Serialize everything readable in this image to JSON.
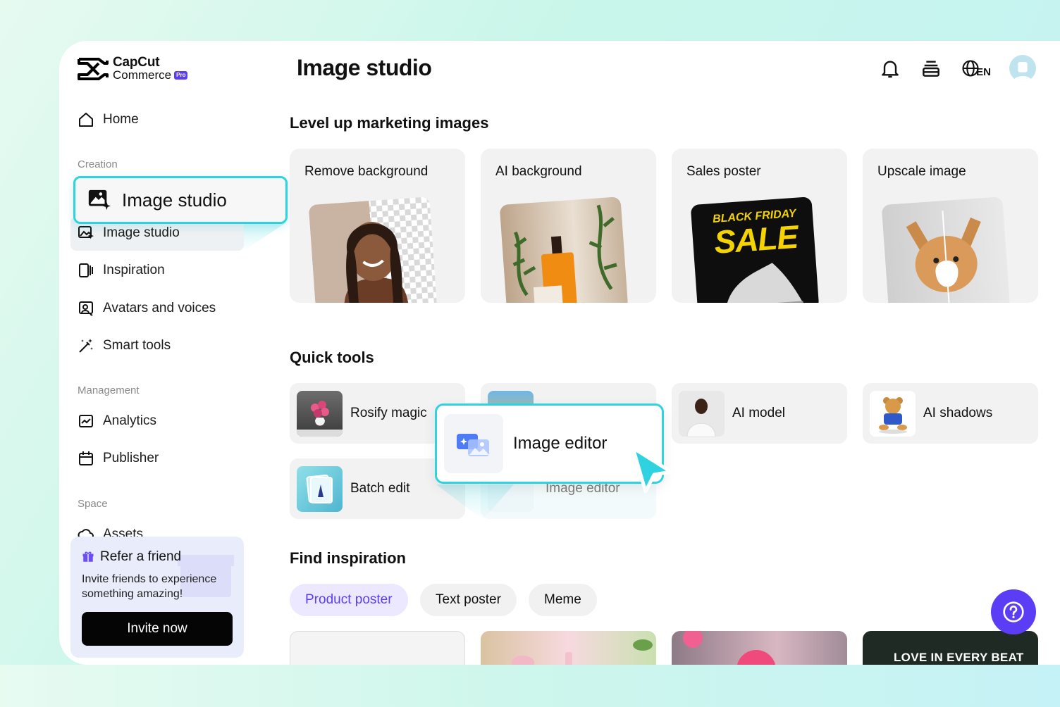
{
  "brand": {
    "line1": "CapCut",
    "line2": "Commerce",
    "badge": "Pro"
  },
  "sidebar": {
    "home": "Home",
    "sections": {
      "creation": "Creation",
      "management": "Management",
      "space": "Space"
    },
    "items": {
      "image_studio": "Image studio",
      "inspiration": "Inspiration",
      "avatars": "Avatars and voices",
      "smart_tools": "Smart tools",
      "analytics": "Analytics",
      "publisher": "Publisher",
      "assets": "Assets"
    },
    "callout": "Image studio"
  },
  "refer": {
    "title": "Refer a friend",
    "desc": "Invite friends to experience something amazing!",
    "button": "Invite now"
  },
  "header": {
    "title": "Image studio",
    "lang": "EN"
  },
  "level_up": {
    "title": "Level up marketing images",
    "cards": [
      "Remove background",
      "AI background",
      "Sales poster",
      "Upscale image"
    ],
    "poster_text": {
      "line1": "BLACK FRIDAY",
      "line2": "SALE"
    }
  },
  "quick_tools": {
    "title": "Quick tools",
    "items": [
      "Rosify magic",
      "Image editor",
      "AI model",
      "AI shadows",
      "Batch edit"
    ],
    "callout": "Image editor"
  },
  "find_inspiration": {
    "title": "Find inspiration",
    "chips": [
      "Product poster",
      "Text poster",
      "Meme"
    ],
    "active_chip": "Product poster",
    "card_text": "LOVE IN EVERY BEAT"
  },
  "colors": {
    "accent": "#5b3df5",
    "highlight": "#2fd3e0"
  }
}
